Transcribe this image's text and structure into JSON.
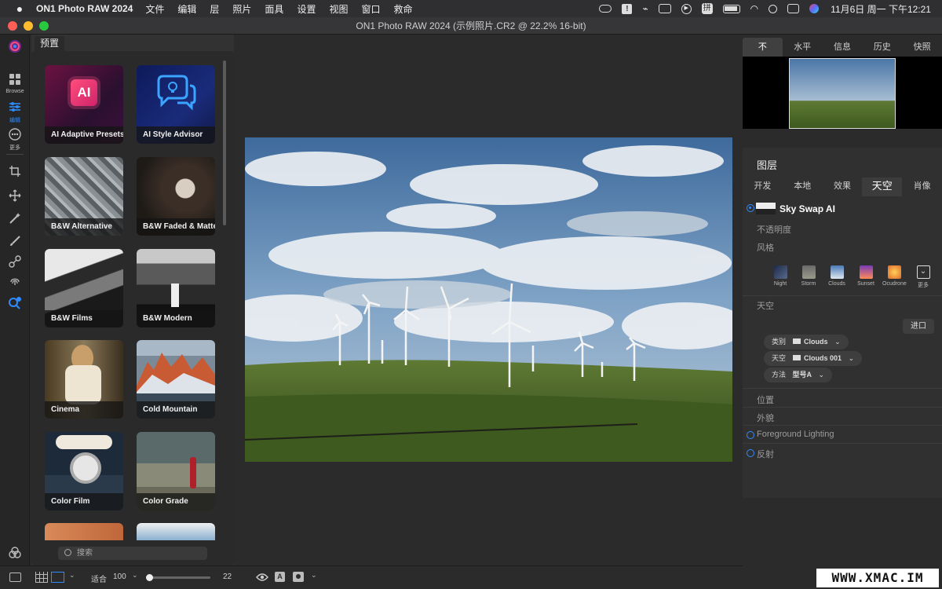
{
  "menubar": {
    "app_name": "ON1 Photo RAW 2024",
    "items": [
      "文件",
      "编辑",
      "层",
      "照片",
      "面具",
      "设置",
      "视图",
      "窗口",
      "救命"
    ],
    "clock": "11月6日 周一 下午12:21"
  },
  "window": {
    "title": "ON1 Photo RAW 2024 (示例照片.CR2 @ 22.2% 16-bit)"
  },
  "left_rail": {
    "browse_label": "Browse",
    "edit_label": "编辑",
    "more_label": "更多"
  },
  "presets": {
    "tab_label": "预置",
    "cards": [
      {
        "label": "AI Adaptive Presets"
      },
      {
        "label": "AI Style Advisor"
      },
      {
        "label": "B&W Alternative"
      },
      {
        "label": "B&W Faded & Matte"
      },
      {
        "label": "B&W Films"
      },
      {
        "label": "B&W Modern"
      },
      {
        "label": "Cinema"
      },
      {
        "label": "Cold Mountain"
      },
      {
        "label": "Color Film"
      },
      {
        "label": "Color Grade"
      }
    ],
    "search_placeholder": "搜索"
  },
  "bottom": {
    "fit_label": "适合",
    "zoom": "100",
    "slider_value": "22",
    "slider_fraction": 0.05
  },
  "navigator": {
    "tabs": [
      "不",
      "水平",
      "信息",
      "历史",
      "快照"
    ]
  },
  "layers": {
    "title": "图层",
    "tabs": [
      "开发",
      "本地",
      "效果",
      "天空",
      "肖像"
    ],
    "filter_name": "Sky Swap AI",
    "opacity_label": "不透明度",
    "style_label": "风格",
    "styles": [
      "Night",
      "Storm",
      "Clouds",
      "Sunset",
      "Ocudrone",
      "更多"
    ],
    "sky_label": "天空",
    "import_button": "进口",
    "category_label": "类别",
    "category_value": "Clouds",
    "sky_field_label": "天空",
    "sky_value": "Clouds 001",
    "method_label": "方法",
    "method_value": "型号A",
    "position_label": "位置",
    "appearance_label": "外貌",
    "foreground_label": "Foreground Lighting",
    "reflection_label": "反射"
  },
  "watermark": "WWW.XMAC.IM",
  "colors": {
    "accent": "#2f8cff",
    "panel": "#303030",
    "canvas": "#2b2b2b"
  }
}
